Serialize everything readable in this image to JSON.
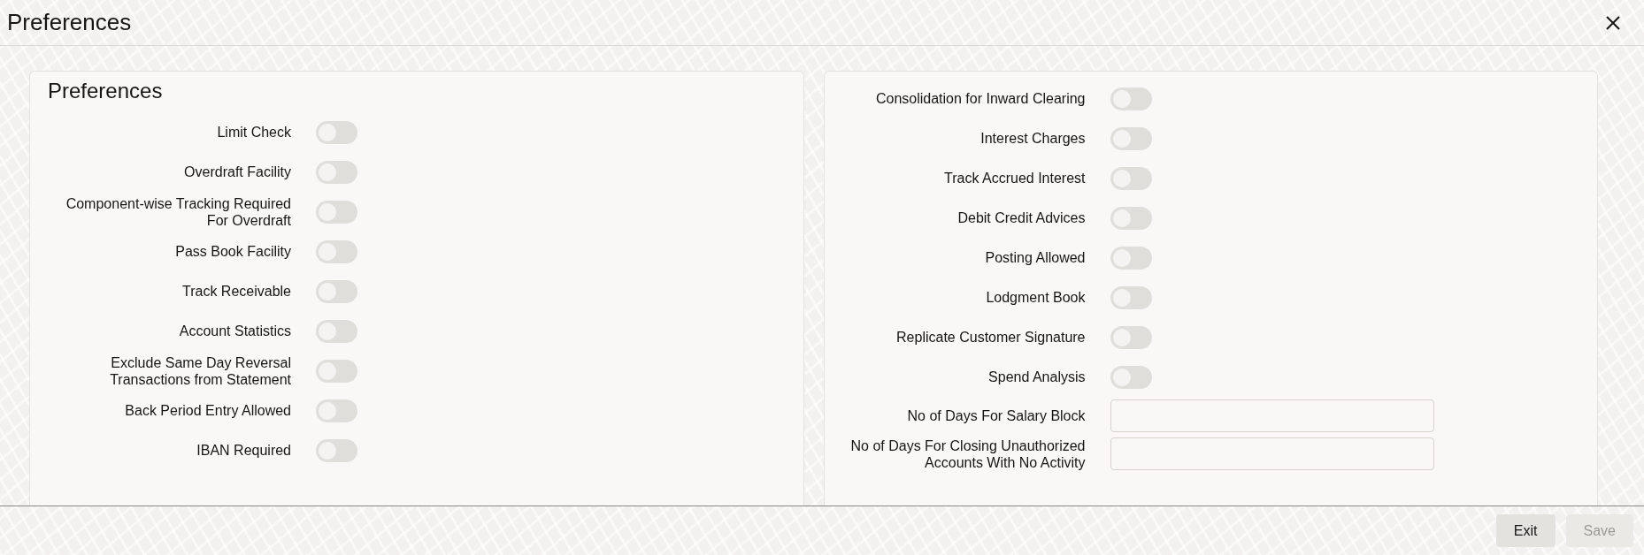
{
  "window": {
    "title": "Preferences"
  },
  "left_panel": {
    "heading": "Preferences",
    "fields": [
      {
        "kind": "toggle",
        "label": "Limit Check",
        "on": false
      },
      {
        "kind": "toggle",
        "label": "Overdraft Facility",
        "on": false
      },
      {
        "kind": "toggle",
        "label": "Component-wise Tracking Required For Overdraft",
        "on": false
      },
      {
        "kind": "toggle",
        "label": "Pass Book Facility",
        "on": false
      },
      {
        "kind": "toggle",
        "label": "Track Receivable",
        "on": false
      },
      {
        "kind": "toggle",
        "label": "Account Statistics",
        "on": false
      },
      {
        "kind": "toggle",
        "label": "Exclude Same Day Reversal Transactions from Statement",
        "on": false
      },
      {
        "kind": "toggle",
        "label": "Back Period Entry Allowed",
        "on": false
      },
      {
        "kind": "toggle",
        "label": "IBAN Required",
        "on": false
      }
    ]
  },
  "right_panel": {
    "fields": [
      {
        "kind": "toggle",
        "label": "Consolidation for Inward Clearing",
        "on": false
      },
      {
        "kind": "toggle",
        "label": "Interest Charges",
        "on": false
      },
      {
        "kind": "toggle",
        "label": "Track Accrued Interest",
        "on": false
      },
      {
        "kind": "toggle",
        "label": "Debit Credit Advices",
        "on": false
      },
      {
        "kind": "toggle",
        "label": "Posting Allowed",
        "on": false
      },
      {
        "kind": "toggle",
        "label": "Lodgment Book",
        "on": false
      },
      {
        "kind": "toggle",
        "label": "Replicate Customer Signature",
        "on": false
      },
      {
        "kind": "toggle",
        "label": "Spend Analysis",
        "on": false
      },
      {
        "kind": "input",
        "label": "No of Days For Salary Block"
      },
      {
        "kind": "input",
        "label": "No of Days For Closing Unauthorized Accounts With No Activity"
      }
    ]
  },
  "footer": {
    "buttons": [
      {
        "label": "Exit",
        "disabled": false
      },
      {
        "label": "Save",
        "disabled": true
      }
    ]
  }
}
